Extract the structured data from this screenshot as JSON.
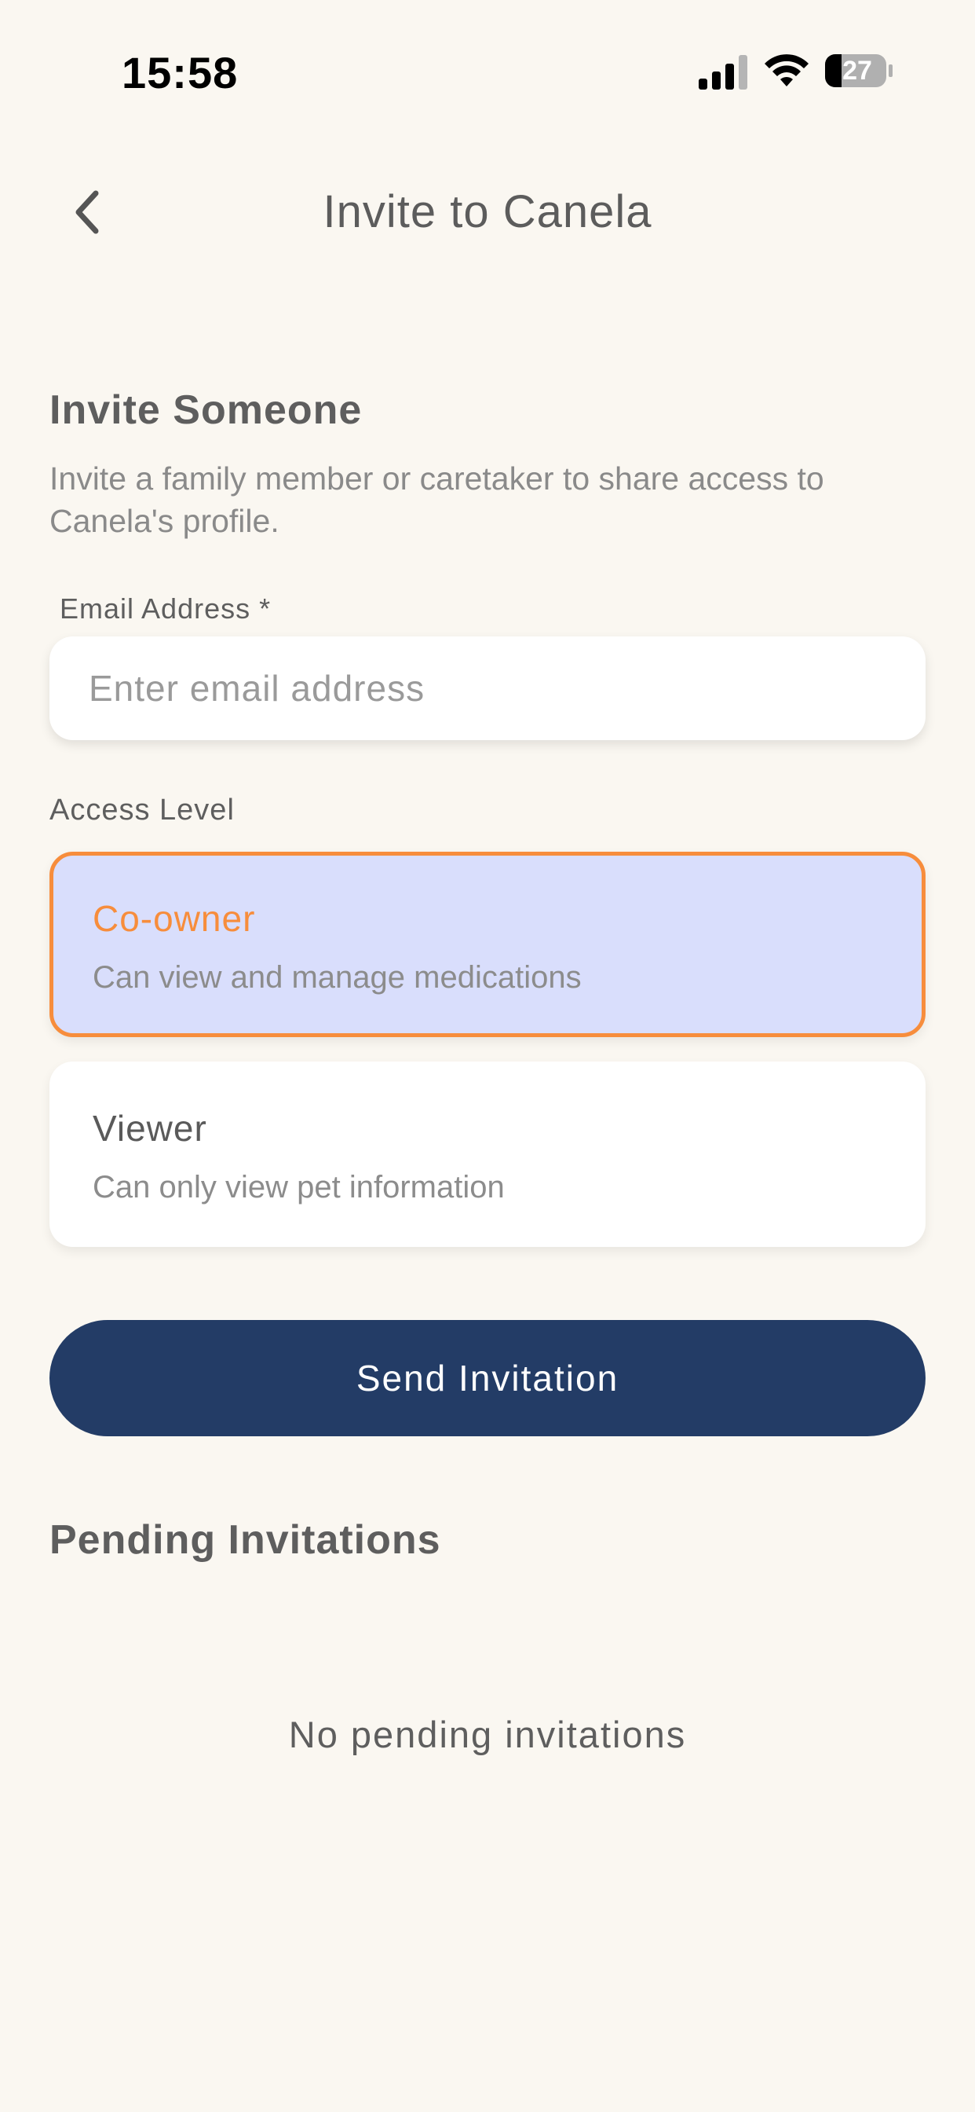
{
  "status_bar": {
    "time": "15:58",
    "battery": "27",
    "icons": [
      "cellular-signal-icon",
      "wifi-icon",
      "battery-icon"
    ]
  },
  "nav": {
    "title": "Invite to Canela",
    "back_icon": "chevron-left-icon"
  },
  "invite": {
    "heading": "Invite Someone",
    "description": "Invite a family member or caretaker to share access to Canela's profile.",
    "email_label": "Email Address *",
    "email_placeholder": "Enter email address",
    "email_value": ""
  },
  "access": {
    "label": "Access Level",
    "options": [
      {
        "title": "Co-owner",
        "subtitle": "Can view and manage medications",
        "selected": true
      },
      {
        "title": "Viewer",
        "subtitle": "Can only view pet information",
        "selected": false
      }
    ]
  },
  "send_button_label": "Send Invitation",
  "pending": {
    "heading": "Pending Invitations",
    "empty_text": "No pending invitations"
  },
  "colors": {
    "background": "#faf7f1",
    "primary": "#233c66",
    "accent": "#f78d3c",
    "selected_bg": "#d9defc"
  }
}
